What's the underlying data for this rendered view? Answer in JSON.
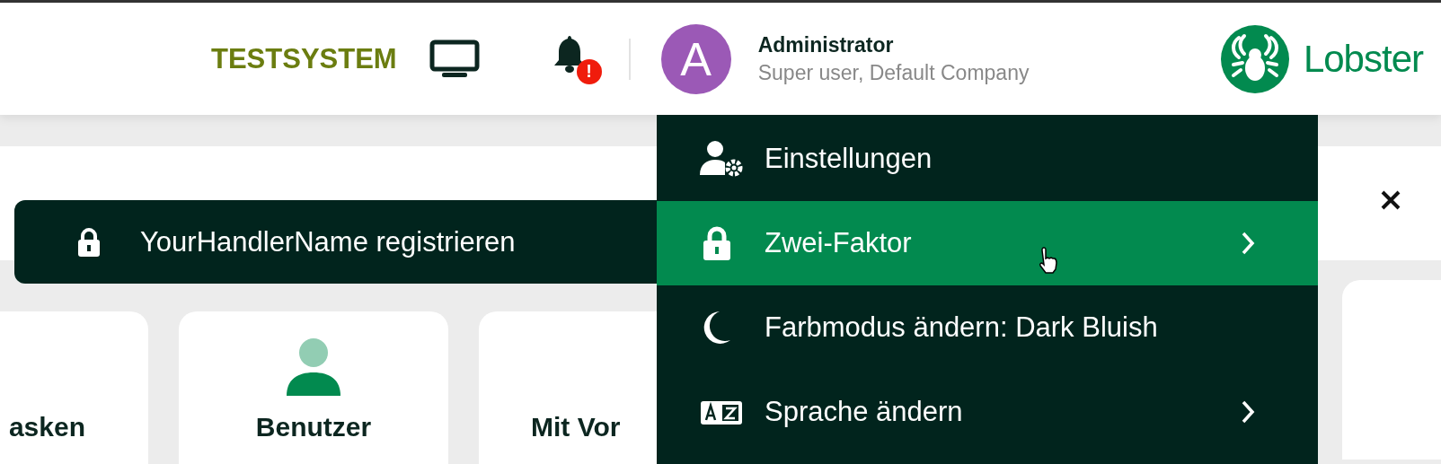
{
  "header": {
    "environment": "TESTSYSTEM",
    "notification_badge": "!",
    "user": {
      "initial": "A",
      "name": "Administrator",
      "role": "Super user, Default Company"
    },
    "logo_text": "Lobster"
  },
  "submenu": {
    "items": [
      {
        "label": "YourHandlerName registrieren"
      }
    ]
  },
  "cards": [
    {
      "label": "asken",
      "icon": false
    },
    {
      "label": "Benutzer",
      "icon": true
    },
    {
      "label": "Mit Vor",
      "icon": false
    }
  ],
  "user_menu": {
    "items": [
      {
        "kind": "settings",
        "label": "Einstellungen",
        "has_submenu": false,
        "selected": false
      },
      {
        "kind": "lock",
        "label": "Zwei-Faktor",
        "has_submenu": true,
        "selected": true
      },
      {
        "kind": "moon",
        "label": "Farbmodus ändern: Dark Bluish",
        "has_submenu": false,
        "selected": false
      },
      {
        "kind": "language",
        "label": "Sprache ändern",
        "has_submenu": true,
        "selected": false
      }
    ]
  }
}
